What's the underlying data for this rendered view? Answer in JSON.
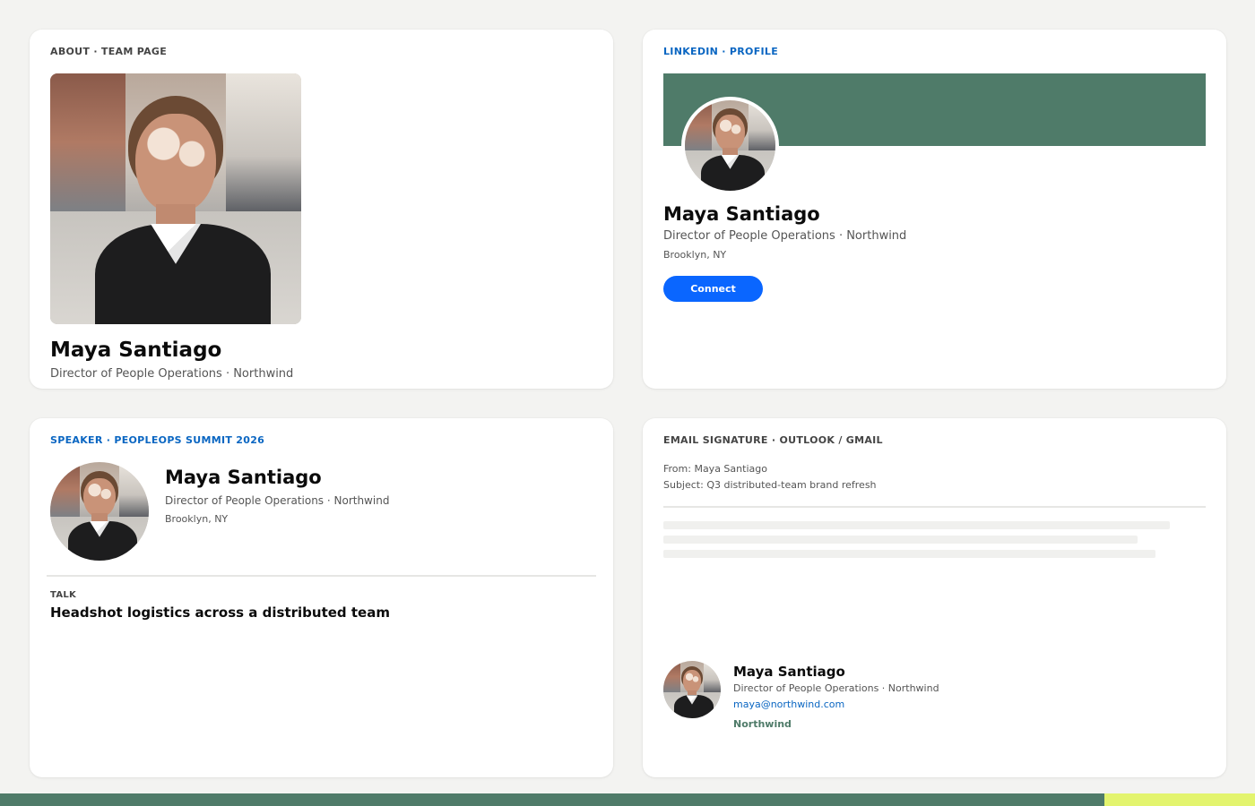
{
  "person": {
    "name": "Maya Santiago",
    "title_line": "Director of People Operations · Northwind",
    "location": "Brooklyn, NY"
  },
  "about": {
    "kicker": "ABOUT · TEAM PAGE"
  },
  "linkedin": {
    "kicker": "LINKEDIN · PROFILE",
    "connect_label": "Connect",
    "banner_color": "#4f7b69",
    "button_color": "#0a66ff"
  },
  "speaker": {
    "kicker": "SPEAKER · PEOPLEOPS SUMMIT 2026",
    "talk_label": "TALK",
    "talk_title": "Headshot logistics across a distributed team"
  },
  "email": {
    "kicker": "EMAIL SIGNATURE · OUTLOOK / GMAIL",
    "from_line": "From: Maya Santiago",
    "subject_line": "Subject: Q3 distributed-team brand refresh",
    "address": "maya@northwind.com",
    "company": "Northwind"
  },
  "colors": {
    "accent_blue": "#0a66c2",
    "brand_green": "#4f7b69",
    "lime": "#e3f46e"
  }
}
